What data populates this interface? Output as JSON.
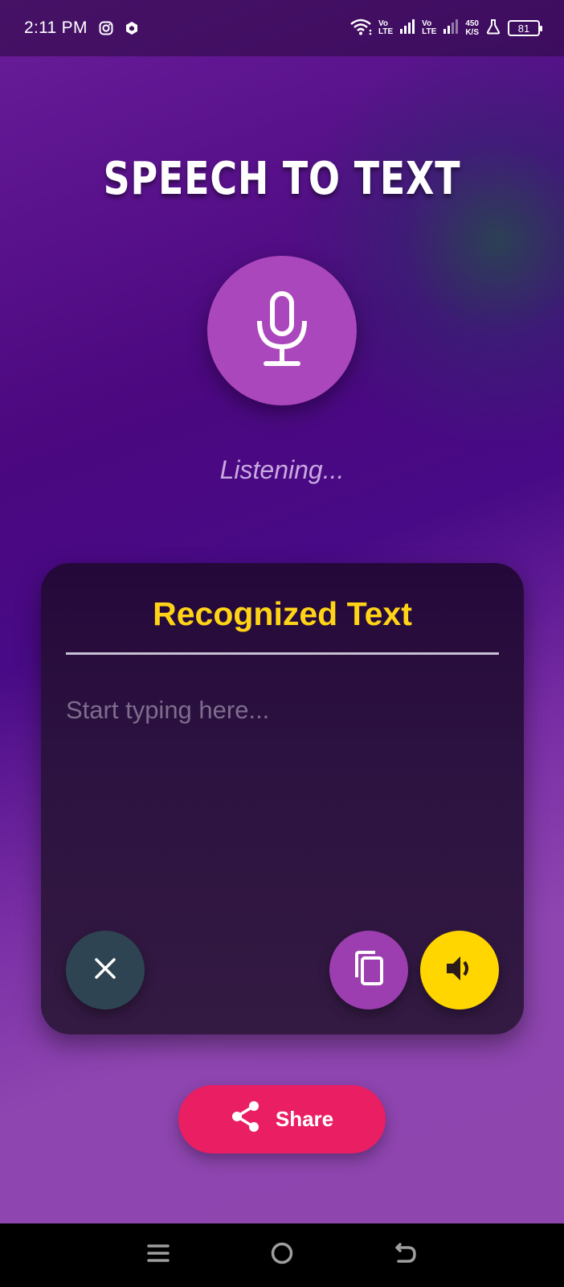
{
  "status_bar": {
    "time": "2:11 PM",
    "sim1_top": "Vo",
    "sim1_bottom": "LTE",
    "sim2_top": "Vo",
    "sim2_bottom": "LTE",
    "speed_value": "450",
    "speed_unit": "K/S",
    "battery": "81",
    "icons": [
      "instagram-icon",
      "shield-app-icon",
      "wifi-icon",
      "signal-icon",
      "signal-icon",
      "lab-flask-icon",
      "battery-icon"
    ]
  },
  "app": {
    "title": "SPEECH TO TEXT",
    "status": "Listening...",
    "mic_icon": "microphone-icon"
  },
  "card": {
    "title": "Recognized Text",
    "text_value": "",
    "placeholder": "Start typing here...",
    "buttons": {
      "clear_icon": "close-icon",
      "copy_icon": "copy-icon",
      "speak_icon": "volume-icon"
    }
  },
  "share": {
    "label": "Share",
    "icon": "share-icon"
  },
  "nav": {
    "icons": [
      "menu-icon",
      "home-icon",
      "back-icon"
    ]
  },
  "colors": {
    "title_yellow": "#ffd416",
    "mic_purple": "#ab47bc",
    "share_pink": "#e91e63",
    "speak_yellow": "#ffd600",
    "clear_slate": "#2e4452"
  }
}
